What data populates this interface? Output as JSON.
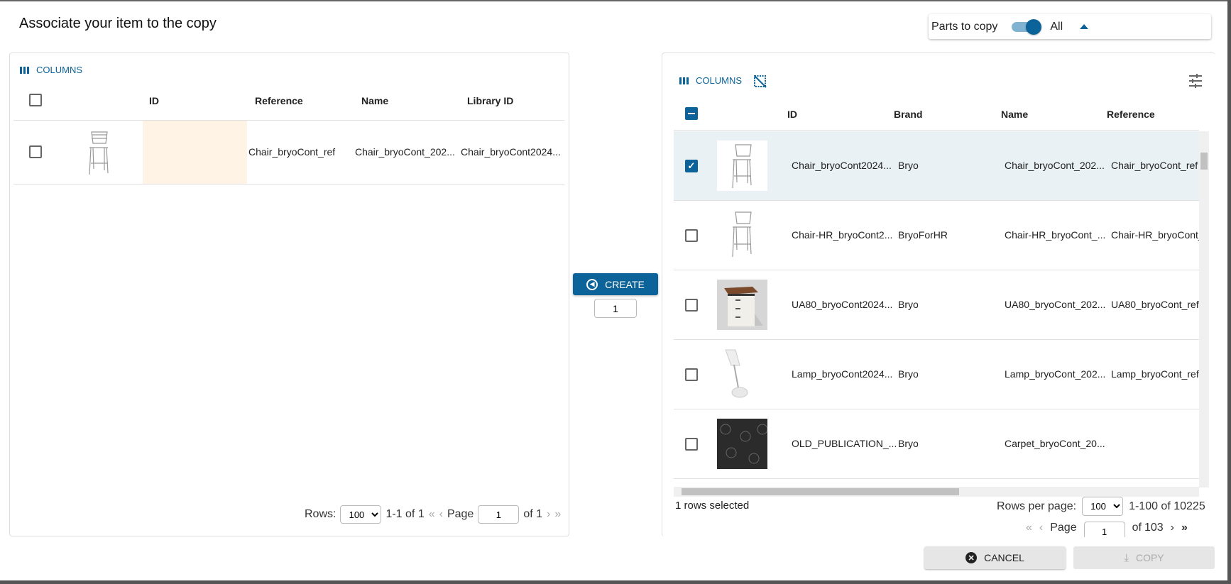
{
  "dialog": {
    "title": "Associate your item to the copy"
  },
  "parts": {
    "label": "Parts to copy",
    "toggle_on": true,
    "value": "All"
  },
  "left": {
    "columns_label": "COLUMNS",
    "headers": [
      "ID",
      "Reference",
      "Name",
      "Library ID"
    ],
    "rows": [
      {
        "id": "",
        "reference": "Chair_bryoCont_ref",
        "name": "Chair_bryoCont_202...",
        "library_id": "Chair_bryoCont2024...",
        "thumb": "bar-stool"
      }
    ],
    "pagination": {
      "rows_label": "Rows:",
      "rows_value": "100",
      "range": "1-1 of 1",
      "page_label": "Page",
      "page": "1",
      "of": "of 1",
      "first": "«",
      "prev": "‹",
      "next": "›",
      "last": "»"
    }
  },
  "middle": {
    "create_label": "CREATE",
    "quantity": "1"
  },
  "right": {
    "columns_label": "COLUMNS",
    "headers": [
      "ID",
      "Brand",
      "Name",
      "Reference"
    ],
    "rows": [
      {
        "checked": true,
        "id": "Chair_bryoCont2024...",
        "brand": "Bryo",
        "name": "Chair_bryoCont_202...",
        "reference": "Chair_bryoCont_ref",
        "thumb": "bar-stool"
      },
      {
        "checked": false,
        "id": "Chair-HR_bryoCont2...",
        "brand": "BryoForHR",
        "name": "Chair-HR_bryoCont_...",
        "reference": "Chair-HR_bryoCont_...",
        "thumb": "bar-stool"
      },
      {
        "checked": false,
        "id": "UA80_bryoCont2024...",
        "brand": "Bryo",
        "name": "UA80_bryoCont_202...",
        "reference": "UA80_bryoCont_ref",
        "thumb": "cabinet"
      },
      {
        "checked": false,
        "id": "Lamp_bryoCont2024...",
        "brand": "Bryo",
        "name": "Lamp_bryoCont_202...",
        "reference": "Lamp_bryoCont_ref",
        "thumb": "lamp"
      },
      {
        "checked": false,
        "id": "OLD_PUBLICATION_...",
        "brand": "Bryo",
        "name": "Carpet_bryoCont_20...",
        "reference": "",
        "thumb": "carpet"
      }
    ],
    "selected_text": "1 rows selected",
    "pagination": {
      "rows_label": "Rows per page:",
      "rows_value": "100",
      "range": "1-100 of 10225",
      "page_label": "Page",
      "page": "1",
      "of": "of",
      "total_pages": "103",
      "first": "«",
      "prev": "‹",
      "next": "›",
      "last": "»"
    }
  },
  "footer": {
    "cancel_label": "CANCEL",
    "copy_label": "COPY"
  },
  "colors": {
    "accent": "#0c6399",
    "selected_row": "#eaf1f5",
    "id_cell_highlight": "#fff3e6"
  }
}
